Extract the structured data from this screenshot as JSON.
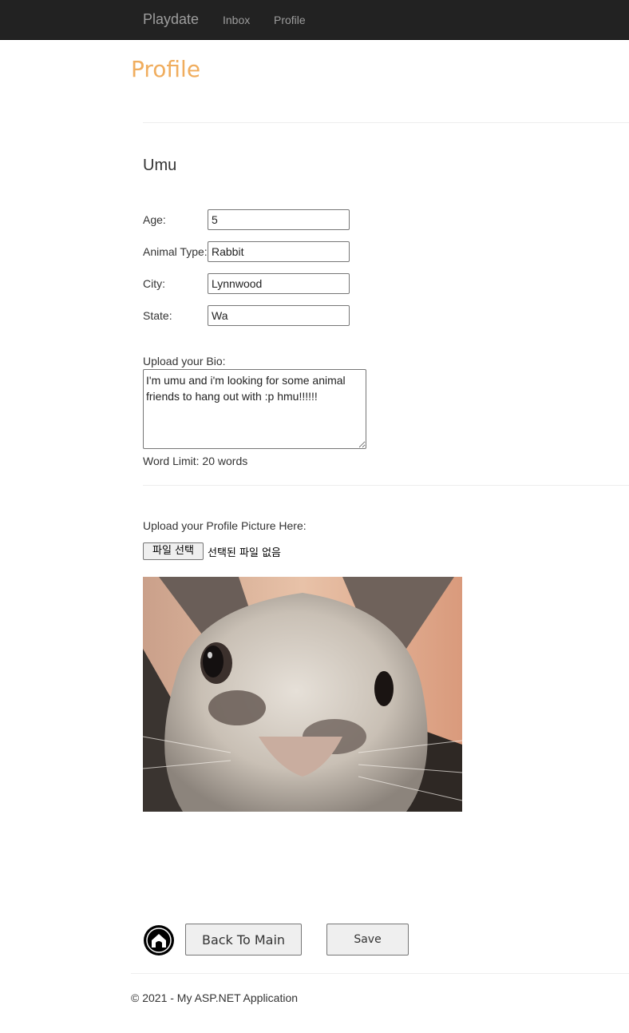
{
  "nav": {
    "brand": "Playdate",
    "inbox": "Inbox",
    "profile": "Profile"
  },
  "page": {
    "title": "Profile"
  },
  "pet": {
    "name": "Umu"
  },
  "fields": [
    {
      "label": "Age:",
      "value": "5"
    },
    {
      "label": "Animal Type:",
      "value": "Rabbit"
    },
    {
      "label": "City:",
      "value": "Lynnwood"
    },
    {
      "label": "State:",
      "value": "Wa"
    }
  ],
  "bio": {
    "label": "Upload your Bio:",
    "value": "I'm umu and i'm looking for some animal friends to hang out with :p hmu!!!!!!",
    "word_limit": "Word Limit: 20 words"
  },
  "picture": {
    "label": "Upload your Profile Picture Here:",
    "choose_file": "파일 선택",
    "no_file": "선택된 파일 없음"
  },
  "actions": {
    "back": "Back To Main",
    "save": "Save"
  },
  "footer": {
    "copyright": "© 2021 - My ASP.NET Application"
  },
  "colors": {
    "navbar": "#222222",
    "title": "#f0ad5e",
    "nav_text": "#9d9d9d"
  },
  "icons": {
    "home": "home-icon"
  }
}
